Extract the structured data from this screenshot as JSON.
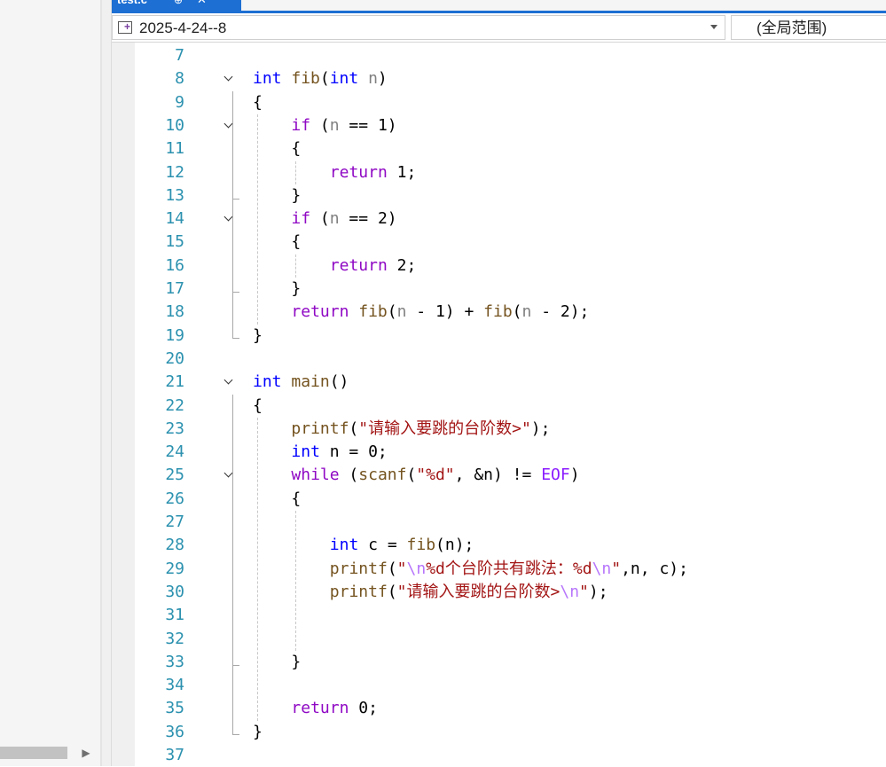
{
  "tab": {
    "title": "test.c",
    "pin": "⊕",
    "close": "✕"
  },
  "navbar": {
    "scope": "2025-4-24--8",
    "global_scope": "(全局范围)"
  },
  "lines": [
    {
      "n": "7",
      "parts": []
    },
    {
      "n": "8",
      "fold": true,
      "parts": [
        [
          "kw",
          "int "
        ],
        [
          "fn",
          "fib"
        ],
        [
          "op",
          "("
        ],
        [
          "kw",
          "int "
        ],
        [
          "var",
          "n"
        ],
        [
          "op",
          ")"
        ]
      ]
    },
    {
      "n": "9",
      "parts": [
        [
          "op",
          "{"
        ]
      ]
    },
    {
      "n": "10",
      "fold": true,
      "ind": 1,
      "parts": [
        [
          "ctl",
          "if "
        ],
        [
          "op",
          "("
        ],
        [
          "var",
          "n"
        ],
        [
          "op",
          " == 1)"
        ]
      ]
    },
    {
      "n": "11",
      "ind": 1,
      "parts": [
        [
          "op",
          "{"
        ]
      ]
    },
    {
      "n": "12",
      "ind": 2,
      "parts": [
        [
          "ctl",
          "return "
        ],
        [
          "op",
          "1;"
        ]
      ]
    },
    {
      "n": "13",
      "ind": 1,
      "parts": [
        [
          "op",
          "}"
        ]
      ]
    },
    {
      "n": "14",
      "fold": true,
      "ind": 1,
      "parts": [
        [
          "ctl",
          "if "
        ],
        [
          "op",
          "("
        ],
        [
          "var",
          "n"
        ],
        [
          "op",
          " == 2)"
        ]
      ]
    },
    {
      "n": "15",
      "ind": 1,
      "parts": [
        [
          "op",
          "{"
        ]
      ]
    },
    {
      "n": "16",
      "ind": 2,
      "parts": [
        [
          "ctl",
          "return "
        ],
        [
          "op",
          "2;"
        ]
      ]
    },
    {
      "n": "17",
      "ind": 1,
      "parts": [
        [
          "op",
          "}"
        ]
      ]
    },
    {
      "n": "18",
      "ind": 1,
      "parts": [
        [
          "ctl",
          "return "
        ],
        [
          "fn",
          "fib"
        ],
        [
          "op",
          "("
        ],
        [
          "var",
          "n"
        ],
        [
          "op",
          " - 1) + "
        ],
        [
          "fn",
          "fib"
        ],
        [
          "op",
          "("
        ],
        [
          "var",
          "n"
        ],
        [
          "op",
          " - 2);"
        ]
      ]
    },
    {
      "n": "19",
      "parts": [
        [
          "op",
          "}"
        ]
      ]
    },
    {
      "n": "20",
      "parts": []
    },
    {
      "n": "21",
      "fold": true,
      "parts": [
        [
          "kw",
          "int "
        ],
        [
          "fn",
          "main"
        ],
        [
          "op",
          "()"
        ]
      ]
    },
    {
      "n": "22",
      "parts": [
        [
          "op",
          "{"
        ]
      ]
    },
    {
      "n": "23",
      "ind": 1,
      "parts": [
        [
          "fn",
          "printf"
        ],
        [
          "op",
          "("
        ],
        [
          "str",
          "\"请输入要跳的台阶数>\""
        ],
        [
          "op",
          ");"
        ]
      ]
    },
    {
      "n": "24",
      "ind": 1,
      "parts": [
        [
          "kw",
          "int "
        ],
        [
          "op",
          "n = 0;"
        ]
      ]
    },
    {
      "n": "25",
      "fold": true,
      "ind": 1,
      "parts": [
        [
          "ctl",
          "while "
        ],
        [
          "op",
          "("
        ],
        [
          "fn",
          "scanf"
        ],
        [
          "op",
          "("
        ],
        [
          "str",
          "\"%d\""
        ],
        [
          "op",
          ", &n) != "
        ],
        [
          "mac",
          "EOF"
        ],
        [
          "op",
          ")"
        ]
      ]
    },
    {
      "n": "26",
      "ind": 1,
      "parts": [
        [
          "op",
          "{"
        ]
      ]
    },
    {
      "n": "27",
      "parts": []
    },
    {
      "n": "28",
      "ind": 2,
      "parts": [
        [
          "kw",
          "int "
        ],
        [
          "op",
          "c = "
        ],
        [
          "fn",
          "fib"
        ],
        [
          "op",
          "(n);"
        ]
      ]
    },
    {
      "n": "29",
      "ind": 2,
      "parts": [
        [
          "fn",
          "printf"
        ],
        [
          "op",
          "("
        ],
        [
          "str",
          "\""
        ],
        [
          "esc",
          "\\n"
        ],
        [
          "str",
          "%d个台阶共有跳法：%d"
        ],
        [
          "esc",
          "\\n"
        ],
        [
          "str",
          "\""
        ],
        [
          "op",
          ",n, c);"
        ]
      ]
    },
    {
      "n": "30",
      "ind": 2,
      "parts": [
        [
          "fn",
          "printf"
        ],
        [
          "op",
          "("
        ],
        [
          "str",
          "\"请输入要跳的台阶数>"
        ],
        [
          "esc",
          "\\n"
        ],
        [
          "str",
          "\""
        ],
        [
          "op",
          ");"
        ]
      ]
    },
    {
      "n": "31",
      "parts": []
    },
    {
      "n": "32",
      "parts": []
    },
    {
      "n": "33",
      "ind": 1,
      "parts": [
        [
          "op",
          "}"
        ]
      ]
    },
    {
      "n": "34",
      "parts": []
    },
    {
      "n": "35",
      "ind": 1,
      "parts": [
        [
          "ctl",
          "return "
        ],
        [
          "op",
          "0;"
        ]
      ]
    },
    {
      "n": "36",
      "parts": [
        [
          "op",
          "}"
        ]
      ]
    },
    {
      "n": "37",
      "parts": []
    }
  ]
}
